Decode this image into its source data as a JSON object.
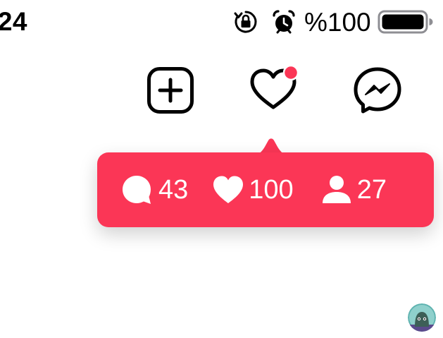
{
  "status_bar": {
    "time": ":24",
    "battery_percent": "%100",
    "icons": [
      "orientation-lock-icon",
      "alarm-icon",
      "battery-icon"
    ],
    "battery_level": 1.0
  },
  "top_actions": {
    "icons": [
      "new-post-icon",
      "heart-icon",
      "messenger-icon"
    ],
    "notification_dot": true
  },
  "activity_bubble": {
    "comments": {
      "icon": "comment-icon",
      "count": "43"
    },
    "likes": {
      "icon": "heart-icon",
      "count": "100"
    },
    "followers": {
      "icon": "user-icon",
      "count": "27"
    }
  },
  "colors": {
    "accent": "#fb3656",
    "text": "#000000",
    "bubble_text": "#ffffff",
    "avatar_bg": "#5fb3b0"
  },
  "avatar": {
    "icon": "avatar-icon"
  }
}
